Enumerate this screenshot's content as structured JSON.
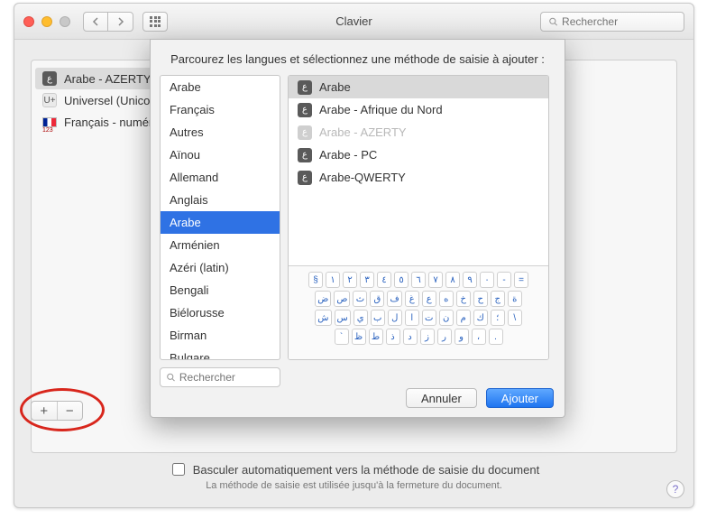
{
  "window": {
    "title": "Clavier",
    "search_placeholder": "Rechercher"
  },
  "sources": [
    {
      "label": "Arabe - AZERTY",
      "icon": "ar"
    },
    {
      "label": "Universel (Unicode)",
      "icon": "uni",
      "iconText": "U+"
    },
    {
      "label": "Français - numérique",
      "icon": "fr"
    }
  ],
  "bottom": {
    "checkbox_label": "Basculer automatiquement vers la méthode de saisie du document",
    "subtext": "La méthode de saisie est utilisée jusqu'à la fermeture du document."
  },
  "sheet": {
    "prompt": "Parcourez les langues et sélectionnez une méthode de saisie à ajouter :",
    "languages": [
      "Arabe",
      "Français",
      "Autres",
      "Aïnou",
      "Allemand",
      "Anglais",
      "Arabe",
      "Arménien",
      "Azéri (latin)",
      "Bengali",
      "Biélorusse",
      "Birman",
      "Bulgare"
    ],
    "selected_lang_index": 6,
    "methods": [
      {
        "label": "Arabe",
        "selected": true
      },
      {
        "label": "Arabe - Afrique du Nord"
      },
      {
        "label": "Arabe - AZERTY",
        "disabled": true
      },
      {
        "label": "Arabe - PC"
      },
      {
        "label": "Arabe-QWERTY"
      }
    ],
    "search_placeholder": "Rechercher",
    "cancel": "Annuler",
    "add": "Ajouter",
    "keyboard_rows": [
      [
        "§",
        "١",
        "٢",
        "٣",
        "٤",
        "٥",
        "٦",
        "٧",
        "٨",
        "٩",
        "٠",
        "-",
        "="
      ],
      [
        "ض",
        "ص",
        "ث",
        "ق",
        "ف",
        "غ",
        "ع",
        "ه",
        "خ",
        "ح",
        "ج",
        "ة"
      ],
      [
        "ش",
        "س",
        "ي",
        "ب",
        "ل",
        "ا",
        "ت",
        "ن",
        "م",
        "ك",
        "؛",
        "\\"
      ],
      [
        "`",
        "ظ",
        "ط",
        "ذ",
        "د",
        "ز",
        "ر",
        "و",
        "،",
        "."
      ]
    ]
  }
}
